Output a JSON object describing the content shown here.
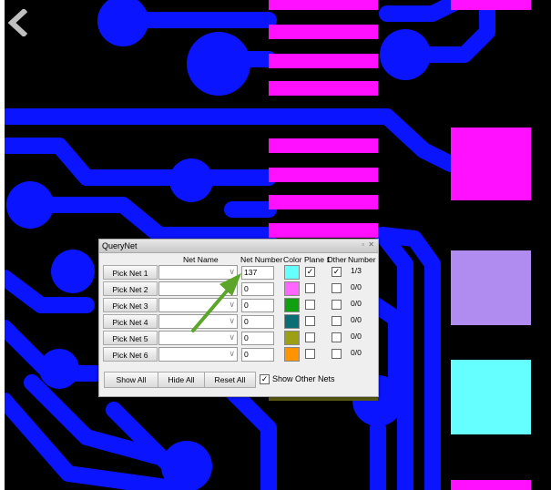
{
  "dialog": {
    "title": "QueryNet",
    "title_controls": "▫ ✕",
    "headers": {
      "net_name": "Net Name",
      "net_number": "Net Number",
      "color": "Color",
      "plane": "Plane 1",
      "other": "Other",
      "number": "Number"
    },
    "rows": [
      {
        "pick_label": "Pick Net 1",
        "net_number": "137",
        "color": "#66ffff",
        "plane_checked": "✓",
        "other_checked": "✓",
        "other_number": "1/3"
      },
      {
        "pick_label": "Pick Net 2",
        "net_number": "0",
        "color": "#ff66ff",
        "plane_checked": "",
        "other_checked": "",
        "other_number": "0/0"
      },
      {
        "pick_label": "Pick Net 3",
        "net_number": "0",
        "color": "#11a011",
        "plane_checked": "",
        "other_checked": "",
        "other_number": "0/0"
      },
      {
        "pick_label": "Pick Net 4",
        "net_number": "0",
        "color": "#0a6e74",
        "plane_checked": "",
        "other_checked": "",
        "other_number": "0/0"
      },
      {
        "pick_label": "Pick Net 5",
        "net_number": "0",
        "color": "#9aa012",
        "plane_checked": "",
        "other_checked": "",
        "other_number": "0/0"
      },
      {
        "pick_label": "Pick Net 6",
        "net_number": "0",
        "color": "#ff9400",
        "plane_checked": "",
        "other_checked": "",
        "other_number": "0/0"
      }
    ],
    "buttons": {
      "show_all": "Show All",
      "hide_all": "Hide All",
      "reset_all": "Reset All"
    },
    "show_other_nets": {
      "label": "Show Other Nets",
      "checked": "✓"
    }
  },
  "colors": {
    "board": "#000000",
    "trace": "#0a14ff",
    "pad": "#ff11ff",
    "highlight": "#66ffff",
    "arrow": "#5ca52a",
    "pad_alt": "#b18cf0"
  },
  "icons": {
    "back": "chevron-left-icon",
    "annotation": "arrow-icon"
  }
}
